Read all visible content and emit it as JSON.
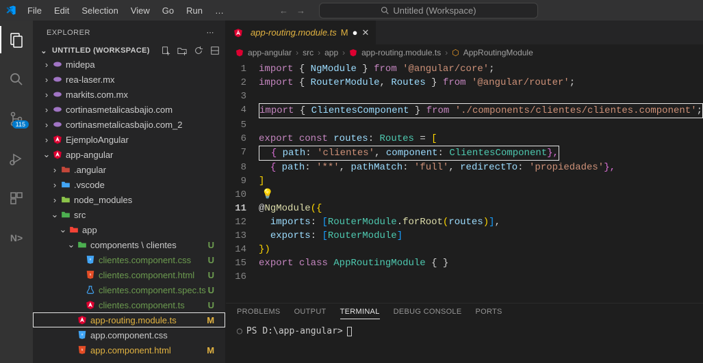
{
  "titlebar": {
    "menu": [
      "File",
      "Edit",
      "Selection",
      "View",
      "Go",
      "Run",
      "…"
    ],
    "search_placeholder": "Untitled (Workspace)"
  },
  "activity": {
    "source_control_badge": "115"
  },
  "sidebar": {
    "title": "EXPLORER",
    "workspace": "UNTITLED (WORKSPACE)",
    "tree": [
      {
        "indent": 1,
        "twist": "›",
        "icon": "php-icon",
        "label": "midepa",
        "color": "#a074c4"
      },
      {
        "indent": 1,
        "twist": "›",
        "icon": "php-icon",
        "label": "rea-laser.mx",
        "color": "#a074c4"
      },
      {
        "indent": 1,
        "twist": "›",
        "icon": "php-icon",
        "label": "markits.com.mx",
        "color": "#a074c4"
      },
      {
        "indent": 1,
        "twist": "›",
        "icon": "php-icon",
        "label": "cortinasmetalicasbajio.com",
        "color": "#a074c4"
      },
      {
        "indent": 1,
        "twist": "›",
        "icon": "php-icon",
        "label": "cortinasmetalicasbajio.com_2",
        "color": "#a074c4"
      },
      {
        "indent": 1,
        "twist": "›",
        "icon": "angular-icon",
        "label": "EjemploAngular",
        "color": "#dd0031"
      },
      {
        "indent": 1,
        "twist": "⌄",
        "icon": "angular-icon",
        "label": "app-angular",
        "color": "#dd0031"
      },
      {
        "indent": 2,
        "twist": "›",
        "icon": "folder-icon",
        "label": ".angular",
        "color": "#c4473a"
      },
      {
        "indent": 2,
        "twist": "›",
        "icon": "folder-icon",
        "label": ".vscode",
        "color": "#42a5f5"
      },
      {
        "indent": 2,
        "twist": "›",
        "icon": "folder-icon",
        "label": "node_modules",
        "color": "#8bc34a"
      },
      {
        "indent": 2,
        "twist": "⌄",
        "icon": "folder-icon",
        "label": "src",
        "color": "#4caf50"
      },
      {
        "indent": 3,
        "twist": "⌄",
        "icon": "folder-icon",
        "label": "app",
        "color": "#f44336"
      },
      {
        "indent": 4,
        "twist": "⌄",
        "icon": "folder-icon",
        "label": "components \\ clientes",
        "color": "#4caf50",
        "status": "U"
      },
      {
        "indent": 5,
        "twist": "",
        "icon": "css-icon",
        "label": "clientes.component.css",
        "color": "#42a5f5",
        "status": "U",
        "git": "u"
      },
      {
        "indent": 5,
        "twist": "",
        "icon": "html-icon",
        "label": "clientes.component.html",
        "color": "#e44d26",
        "status": "U",
        "git": "u"
      },
      {
        "indent": 5,
        "twist": "",
        "icon": "test-icon",
        "label": "clientes.component.spec.ts",
        "color": "#42a5f5",
        "status": "U",
        "git": "u"
      },
      {
        "indent": 5,
        "twist": "",
        "icon": "angular-icon",
        "label": "clientes.component.ts",
        "color": "#dd0031",
        "status": "U",
        "git": "u"
      },
      {
        "indent": 4,
        "twist": "",
        "icon": "angular-icon",
        "label": "app-routing.module.ts",
        "color": "#dd0031",
        "status": "M",
        "git": "m",
        "selected": true
      },
      {
        "indent": 4,
        "twist": "",
        "icon": "css-icon",
        "label": "app.component.css",
        "color": "#42a5f5"
      },
      {
        "indent": 4,
        "twist": "",
        "icon": "html-icon",
        "label": "app.component.html",
        "color": "#e44d26",
        "status": "M",
        "git": "m"
      }
    ]
  },
  "editor": {
    "tab_name": "app-routing.module.ts",
    "tab_status": "M",
    "breadcrumb": [
      "app-angular",
      "src",
      "app",
      "app-routing.module.ts",
      "AppRoutingModule"
    ],
    "code": {
      "l1": {
        "p1": "import",
        "p2": " { ",
        "p3": "NgModule",
        "p4": " } ",
        "p5": "from",
        "p6": " ",
        "p7": "'@angular/core'",
        "p8": ";"
      },
      "l2": {
        "p1": "import",
        "p2": " { ",
        "p3": "RouterModule",
        "p4": ", ",
        "p5": "Routes",
        "p6": " } ",
        "p7": "from",
        "p8": " ",
        "p9": "'@angular/router'",
        "p10": ";"
      },
      "l4": {
        "p1": "import",
        "p2": " { ",
        "p3": "ClientesComponent",
        "p4": " } ",
        "p5": "from",
        "p6": " ",
        "p7": "'./components/clientes/clientes.component'",
        "p8": ";"
      },
      "l6": {
        "p1": "export",
        "p2": " ",
        "p3": "const",
        "p4": " ",
        "p5": "routes",
        "p6": ": ",
        "p7": "Routes",
        "p8": " = ",
        "p9": "["
      },
      "l7": {
        "p1": "  { ",
        "p2": "path",
        "p3": ": ",
        "p4": "'clientes'",
        "p5": ", ",
        "p6": "component",
        "p7": ": ",
        "p8": "ClientesComponent",
        "p9": "},"
      },
      "l8": {
        "p1": "  { ",
        "p2": "path",
        "p3": ": ",
        "p4": "'**'",
        "p5": ", ",
        "p6": "pathMatch",
        "p7": ": ",
        "p8": "'full'",
        "p9": ", ",
        "p10": "redirectTo",
        "p11": ": ",
        "p12": "'propiedades'",
        "p13": "},"
      },
      "l9": {
        "p1": "]"
      },
      "l11": {
        "p1": "@",
        "p2": "NgModule",
        "p3": "({"
      },
      "l12": {
        "p1": "  ",
        "p2": "imports",
        "p3": ": ",
        "p4": "[",
        "p5": "RouterModule",
        "p6": ".",
        "p7": "forRoot",
        "p8": "(",
        "p9": "routes",
        "p10": ")",
        "p11": "]",
        "p12": ","
      },
      "l13": {
        "p1": "  ",
        "p2": "exports",
        "p3": ": ",
        "p4": "[",
        "p5": "RouterModule",
        "p6": "]"
      },
      "l14": {
        "p1": "})"
      },
      "l15": {
        "p1": "export",
        "p2": " ",
        "p3": "class",
        "p4": " ",
        "p5": "AppRoutingModule",
        "p6": " { }"
      }
    }
  },
  "panel": {
    "tabs": [
      "PROBLEMS",
      "OUTPUT",
      "TERMINAL",
      "DEBUG CONSOLE",
      "PORTS"
    ],
    "active_tab": "TERMINAL",
    "prompt": "PS D:\\app-angular> "
  }
}
